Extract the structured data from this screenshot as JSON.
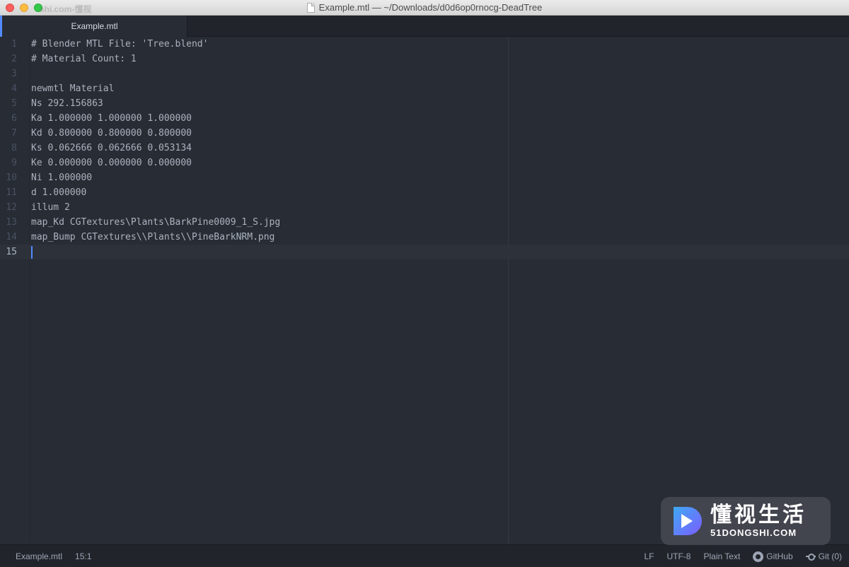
{
  "window": {
    "title": "Example.mtl — ~/Downloads/d0d6op0rnocg-DeadTree",
    "watermark_top": "shi.com-懂视"
  },
  "tabs": [
    {
      "label": "Example.mtl",
      "active": true
    }
  ],
  "editor": {
    "current_line": 15,
    "lines": [
      {
        "n": "1",
        "text": "# Blender MTL File: 'Tree.blend'"
      },
      {
        "n": "2",
        "text": "# Material Count: 1"
      },
      {
        "n": "3",
        "text": ""
      },
      {
        "n": "4",
        "text": "newmtl Material"
      },
      {
        "n": "5",
        "text": "Ns 292.156863"
      },
      {
        "n": "6",
        "text": "Ka 1.000000 1.000000 1.000000"
      },
      {
        "n": "7",
        "text": "Kd 0.800000 0.800000 0.800000"
      },
      {
        "n": "8",
        "text": "Ks 0.062666 0.062666 0.053134"
      },
      {
        "n": "9",
        "text": "Ke 0.000000 0.000000 0.000000"
      },
      {
        "n": "10",
        "text": "Ni 1.000000"
      },
      {
        "n": "11",
        "text": "d 1.000000"
      },
      {
        "n": "12",
        "text": "illum 2"
      },
      {
        "n": "13",
        "text": "map_Kd CGTextures\\Plants\\BarkPine0009_1_S.jpg"
      },
      {
        "n": "14",
        "text": "map_Bump CGTextures\\\\Plants\\\\PineBarkNRM.png"
      },
      {
        "n": "15",
        "text": ""
      }
    ]
  },
  "statusbar": {
    "file": "Example.mtl",
    "cursor_pos": "15:1",
    "line_ending": "LF",
    "encoding": "UTF-8",
    "grammar": "Plain Text",
    "github": "GitHub",
    "git": "Git (0)"
  },
  "watermark": {
    "cn": "懂视生活",
    "en": "51DONGSHI.COM"
  },
  "colors": {
    "editor_bg": "#282c34",
    "accent": "#528bff",
    "text": "#abb2bf"
  }
}
